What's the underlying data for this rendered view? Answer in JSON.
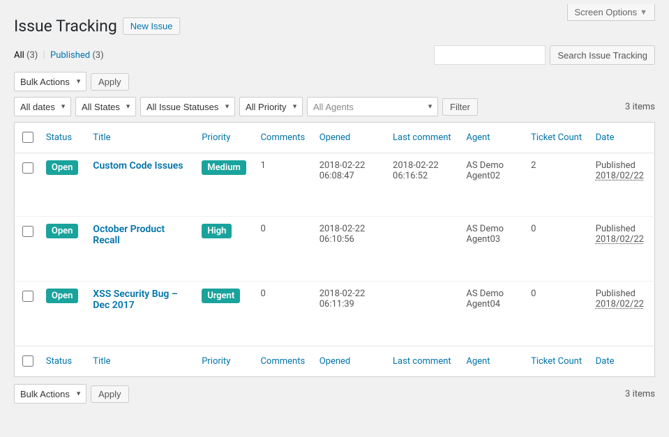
{
  "screen_options_label": "Screen Options",
  "page_title": "Issue Tracking",
  "new_issue_label": "New Issue",
  "views": {
    "all_label": "All",
    "all_count": "(3)",
    "published_label": "Published",
    "published_count": "(3)"
  },
  "search": {
    "button": "Search Issue Tracking"
  },
  "bulk": {
    "select_label": "Bulk Actions",
    "apply_label": "Apply"
  },
  "filters": {
    "dates": "All dates",
    "states": "All States",
    "statuses": "All Issue Statuses",
    "priority": "All Priority",
    "agents_placeholder": "All Agents",
    "filter_button": "Filter"
  },
  "items_text": "3 items",
  "columns": {
    "status": "Status",
    "title": "Title",
    "priority": "Priority",
    "comments": "Comments",
    "opened": "Opened",
    "last_comment": "Last comment",
    "agent": "Agent",
    "ticket_count": "Ticket Count",
    "date": "Date"
  },
  "rows": [
    {
      "status": "Open",
      "title": "Custom Code Issues",
      "priority": "Medium",
      "comments": "1",
      "opened": "2018-02-22 06:08:47",
      "last_comment": "2018-02-22 06:16:52",
      "agent": "AS Demo Agent02",
      "ticket_count": "2",
      "date_state": "Published",
      "date": "2018/02/22"
    },
    {
      "status": "Open",
      "title": "October Product Recall",
      "priority": "High",
      "comments": "0",
      "opened": "2018-02-22 06:10:56",
      "last_comment": "",
      "agent": "AS Demo Agent03",
      "ticket_count": "0",
      "date_state": "Published",
      "date": "2018/02/22"
    },
    {
      "status": "Open",
      "title": "XSS Security Bug – Dec 2017",
      "priority": "Urgent",
      "comments": "0",
      "opened": "2018-02-22 06:11:39",
      "last_comment": "",
      "agent": "AS Demo Agent04",
      "ticket_count": "0",
      "date_state": "Published",
      "date": "2018/02/22"
    }
  ]
}
